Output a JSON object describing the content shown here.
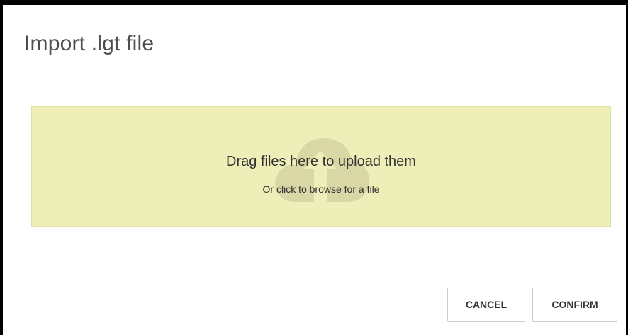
{
  "dialog": {
    "title": "Import .lgt file"
  },
  "dropzone": {
    "heading": "Drag files here to upload them",
    "subtext": "Or click to browse for a file",
    "icon": "cloud-upload-icon",
    "background_color": "#eeefb8"
  },
  "actions": {
    "cancel_label": "CANCEL",
    "confirm_label": "CONFIRM"
  }
}
